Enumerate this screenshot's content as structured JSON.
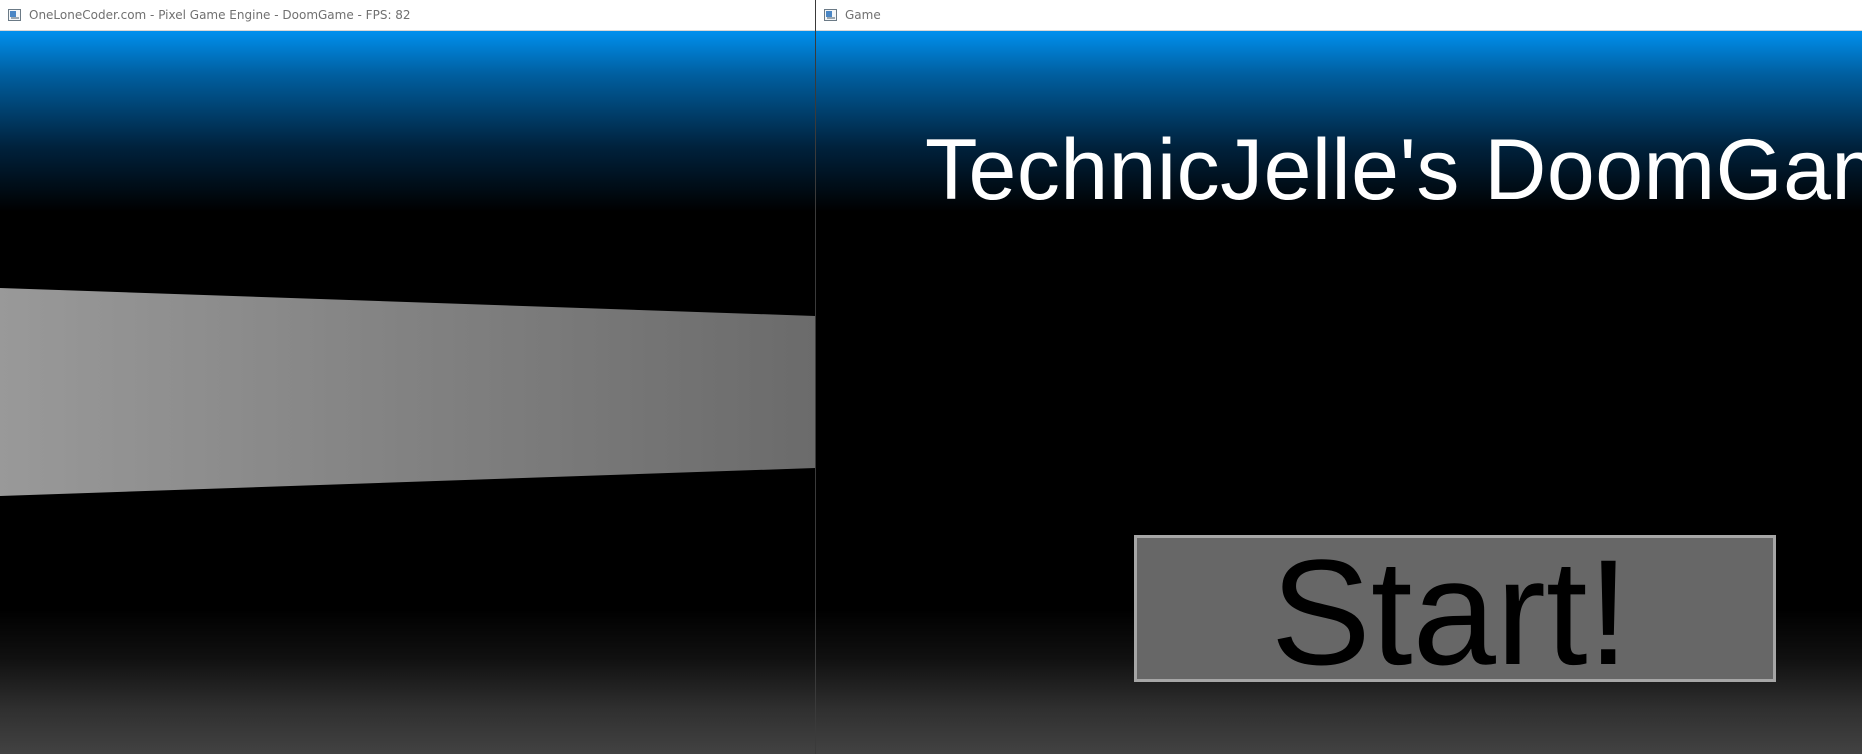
{
  "left_window": {
    "title": "OneLoneCoder.com - Pixel Game Engine - DoomGame - FPS: 82",
    "icon": "window-app-icon"
  },
  "right_window": {
    "title": "Game",
    "icon": "window-app-icon",
    "game_title": "TechnicJelle's DoomGame",
    "start_button_label": "Start!"
  },
  "colors": {
    "sky_top": "#0090ee",
    "floor_bottom": "#424242",
    "wall_near": "#999999",
    "wall_far": "#6b6b6b",
    "button_fill": "#676767",
    "button_border": "#a6a6a6"
  }
}
